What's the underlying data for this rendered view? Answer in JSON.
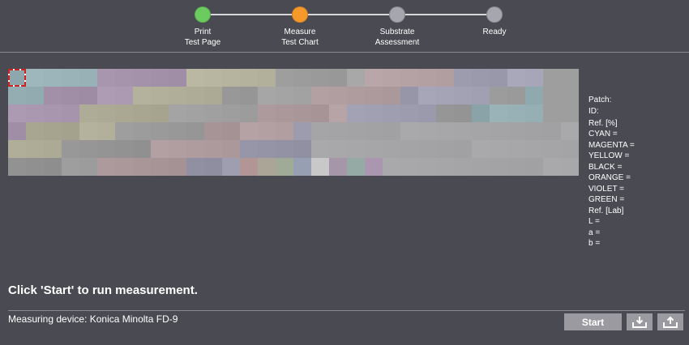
{
  "stepper": {
    "steps": [
      {
        "label": "Print\nTest Page",
        "state": "done",
        "color": "#6ccb5f"
      },
      {
        "label": "Measure\nTest Chart",
        "state": "active",
        "color": "#f59a2a"
      },
      {
        "label": "Substrate\nAssessment",
        "state": "pending",
        "color": "#a5a6ae"
      },
      {
        "label": "Ready",
        "state": "pending",
        "color": "#a5a6ae"
      }
    ]
  },
  "patch_info": {
    "patch_label": "Patch:",
    "id_label": "ID:",
    "ref_percent_label": "Ref. [%]",
    "cyan": "CYAN =",
    "magenta": "MAGENTA =",
    "yellow": "YELLOW =",
    "black": "BLACK =",
    "orange": "ORANGE =",
    "violet": "VIOLET =",
    "green": "GREEN =",
    "ref_lab_label": "Ref. [Lab]",
    "l": "L =",
    "a": "a =",
    "b": "b ="
  },
  "instruction": "Click 'Start' to run measurement.",
  "footer": {
    "device": "Measuring device: Konica Minolta FD-9",
    "start_label": "Start",
    "import_icon": "import-icon",
    "export_icon": "export-icon"
  },
  "colors": {
    "background": "#4a4a52",
    "button": "#9a9aa0",
    "selection": "#cc2222"
  }
}
